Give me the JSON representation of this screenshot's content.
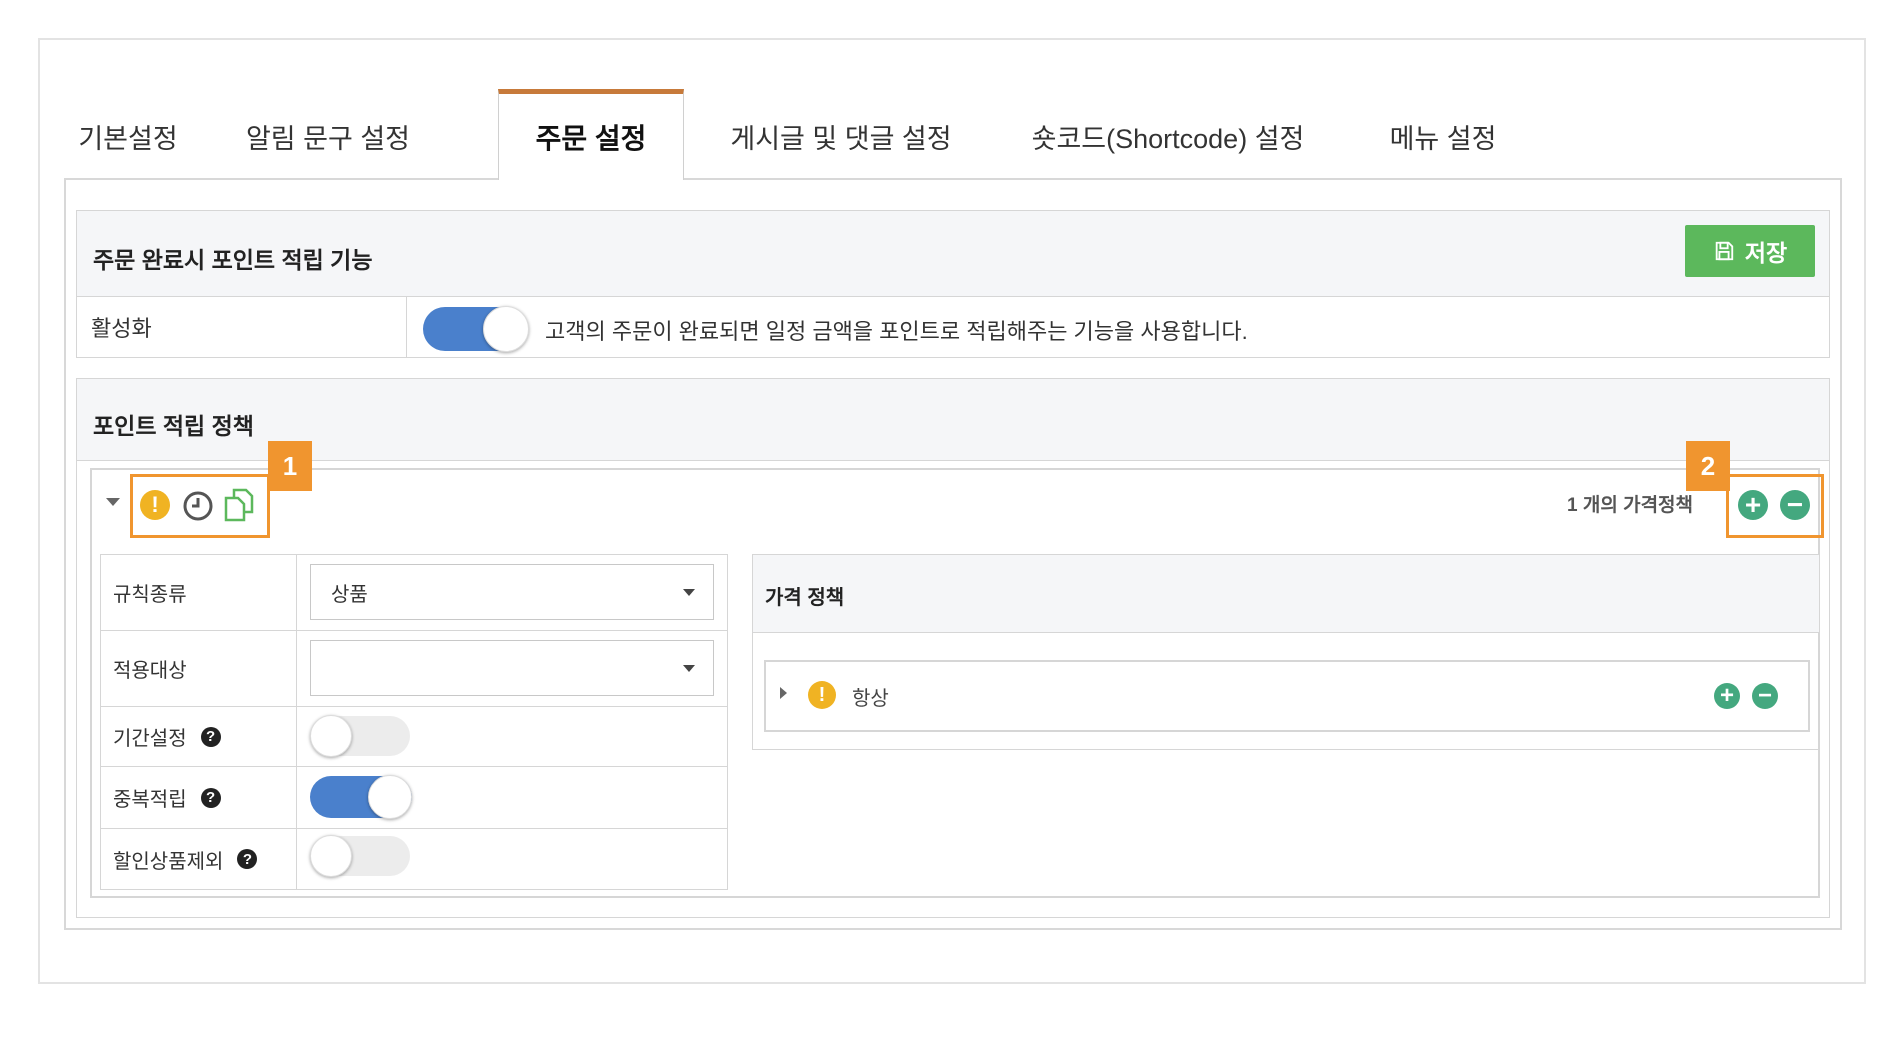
{
  "tabs": [
    {
      "label": "기본설정"
    },
    {
      "label": "알림 문구 설정"
    },
    {
      "label": "주문 설정"
    },
    {
      "label": "게시글 및 댓글 설정"
    },
    {
      "label": "숏코드(Shortcode) 설정"
    },
    {
      "label": "메뉴 설정"
    }
  ],
  "active_tab": "주문 설정",
  "points_section": {
    "title": "주문 완료시 포인트 적립 기능",
    "save_label": "저장",
    "save_icon": "floppy-disk-icon",
    "enable_label": "활성화",
    "enable_state": "on",
    "enable_description": "고객의 주문이 완료되면 일정 금액을 포인트로 적립해주는 기능을 사용합니다."
  },
  "policy_section": {
    "title": "포인트 적립 정책",
    "callout_1": "1",
    "callout_2": "2",
    "rule_icons": [
      "warning-icon",
      "clock-icon",
      "copy-icon"
    ],
    "count_text": "1 개의 가격정책",
    "fields": {
      "rule_type_label": "규칙종류",
      "rule_type_value": "상품",
      "target_label": "적용대상",
      "target_value": "",
      "period_label": "기간설정",
      "period_state": "off",
      "duplicate_label": "중복적립",
      "duplicate_state": "on",
      "exclude_sale_label": "할인상품제외",
      "exclude_sale_state": "off",
      "help_glyph": "?"
    },
    "price_policy": {
      "title": "가격 정책",
      "item_label": "항상"
    }
  },
  "colors": {
    "accent_tab": "#c77a3a",
    "save_green": "#5cb85c",
    "toggle_on": "#4a80cc",
    "callout_orange": "#f0952f",
    "warning_yellow": "#f0b323",
    "action_green": "#44a87f"
  }
}
